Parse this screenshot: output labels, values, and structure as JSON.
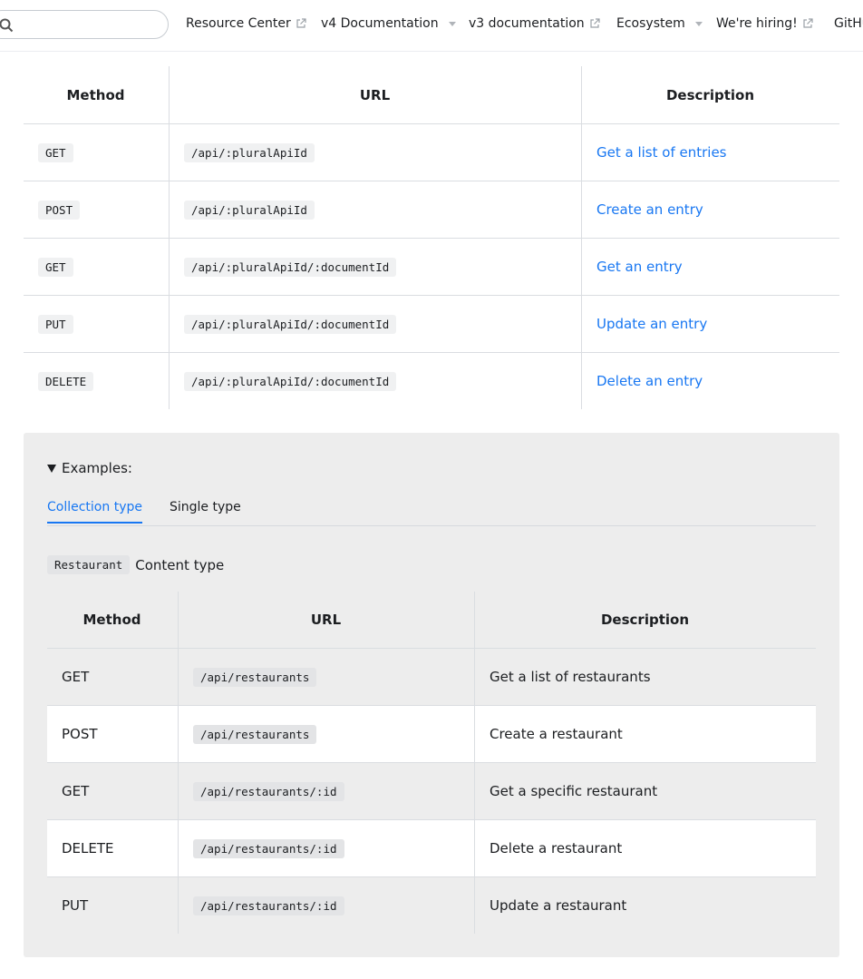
{
  "navbar": {
    "search_placeholder": "",
    "items": [
      {
        "label": "Resource Center",
        "icon": "external-link-icon"
      },
      {
        "label": "v4 Documentation",
        "icon": "caret-down-icon"
      },
      {
        "label": "v3 documentation",
        "icon": "external-link-icon"
      },
      {
        "label": "Ecosystem",
        "icon": "caret-down-icon"
      },
      {
        "label": "We're hiring!",
        "icon": "external-link-icon"
      },
      {
        "label": "GitHub",
        "icon": "external-link-icon"
      }
    ]
  },
  "endpoints_table": {
    "headers": [
      "Method",
      "URL",
      "Description"
    ],
    "rows": [
      {
        "method": "GET",
        "url": "/api/:pluralApiId",
        "description": "Get a list of entries"
      },
      {
        "method": "POST",
        "url": "/api/:pluralApiId",
        "description": "Create an entry"
      },
      {
        "method": "GET",
        "url": "/api/:pluralApiId/:documentId",
        "description": "Get an entry"
      },
      {
        "method": "PUT",
        "url": "/api/:pluralApiId/:documentId",
        "description": "Update an entry"
      },
      {
        "method": "DELETE",
        "url": "/api/:pluralApiId/:documentId",
        "description": "Delete an entry"
      }
    ]
  },
  "examples": {
    "summary": "Examples:",
    "tabs": [
      {
        "label": "Collection type",
        "active": true
      },
      {
        "label": "Single type",
        "active": false
      }
    ],
    "content_type_code": "Restaurant",
    "content_type_text": "Content type",
    "table": {
      "headers": [
        "Method",
        "URL",
        "Description"
      ],
      "rows": [
        {
          "method": "GET",
          "url": "/api/restaurants",
          "description": "Get a list of restaurants"
        },
        {
          "method": "POST",
          "url": "/api/restaurants",
          "description": "Create a restaurant"
        },
        {
          "method": "GET",
          "url": "/api/restaurants/:id",
          "description": "Get a specific restaurant"
        },
        {
          "method": "DELETE",
          "url": "/api/restaurants/:id",
          "description": "Delete a restaurant"
        },
        {
          "method": "PUT",
          "url": "/api/restaurants/:id",
          "description": "Update a restaurant"
        }
      ]
    }
  },
  "colors": {
    "link": "#1877f2",
    "panel_bg": "#ededed",
    "text": "#1c1e21"
  }
}
